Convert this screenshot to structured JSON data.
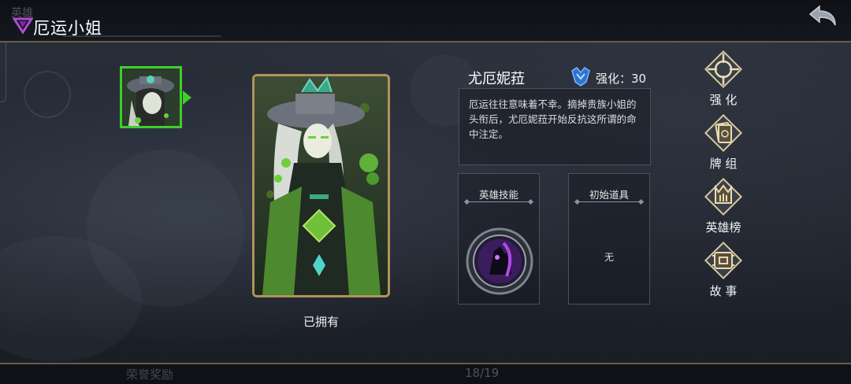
{
  "header": {
    "ghost_text": "英雄",
    "title": "厄运小姐",
    "back_icon": "back-arrow-icon"
  },
  "footer": {
    "left_text": "荣誉奖励",
    "page": "18/19"
  },
  "hero": {
    "name": "尤厄妮菈",
    "enhance_label": "强化：30",
    "description": "厄运往往意味着不幸。摘掉贵族小姐的头衔后，尤厄妮菈开始反抗这所谓的命中注定。",
    "owned_label": "已拥有"
  },
  "panels": {
    "skill_title": "英雄技能",
    "item_title": "初始道具",
    "item_value": "无"
  },
  "side_menu": [
    {
      "label": "强  化",
      "icon": "enhance-icon"
    },
    {
      "label": "牌  组",
      "icon": "deck-icon"
    },
    {
      "label": "英雄榜",
      "icon": "hero-rank-icon"
    },
    {
      "label": "故  事",
      "icon": "story-icon"
    }
  ],
  "colors": {
    "frame_gold": "#b39259",
    "selected_green": "#3fce2a",
    "bar_border": "#6b5d43"
  }
}
